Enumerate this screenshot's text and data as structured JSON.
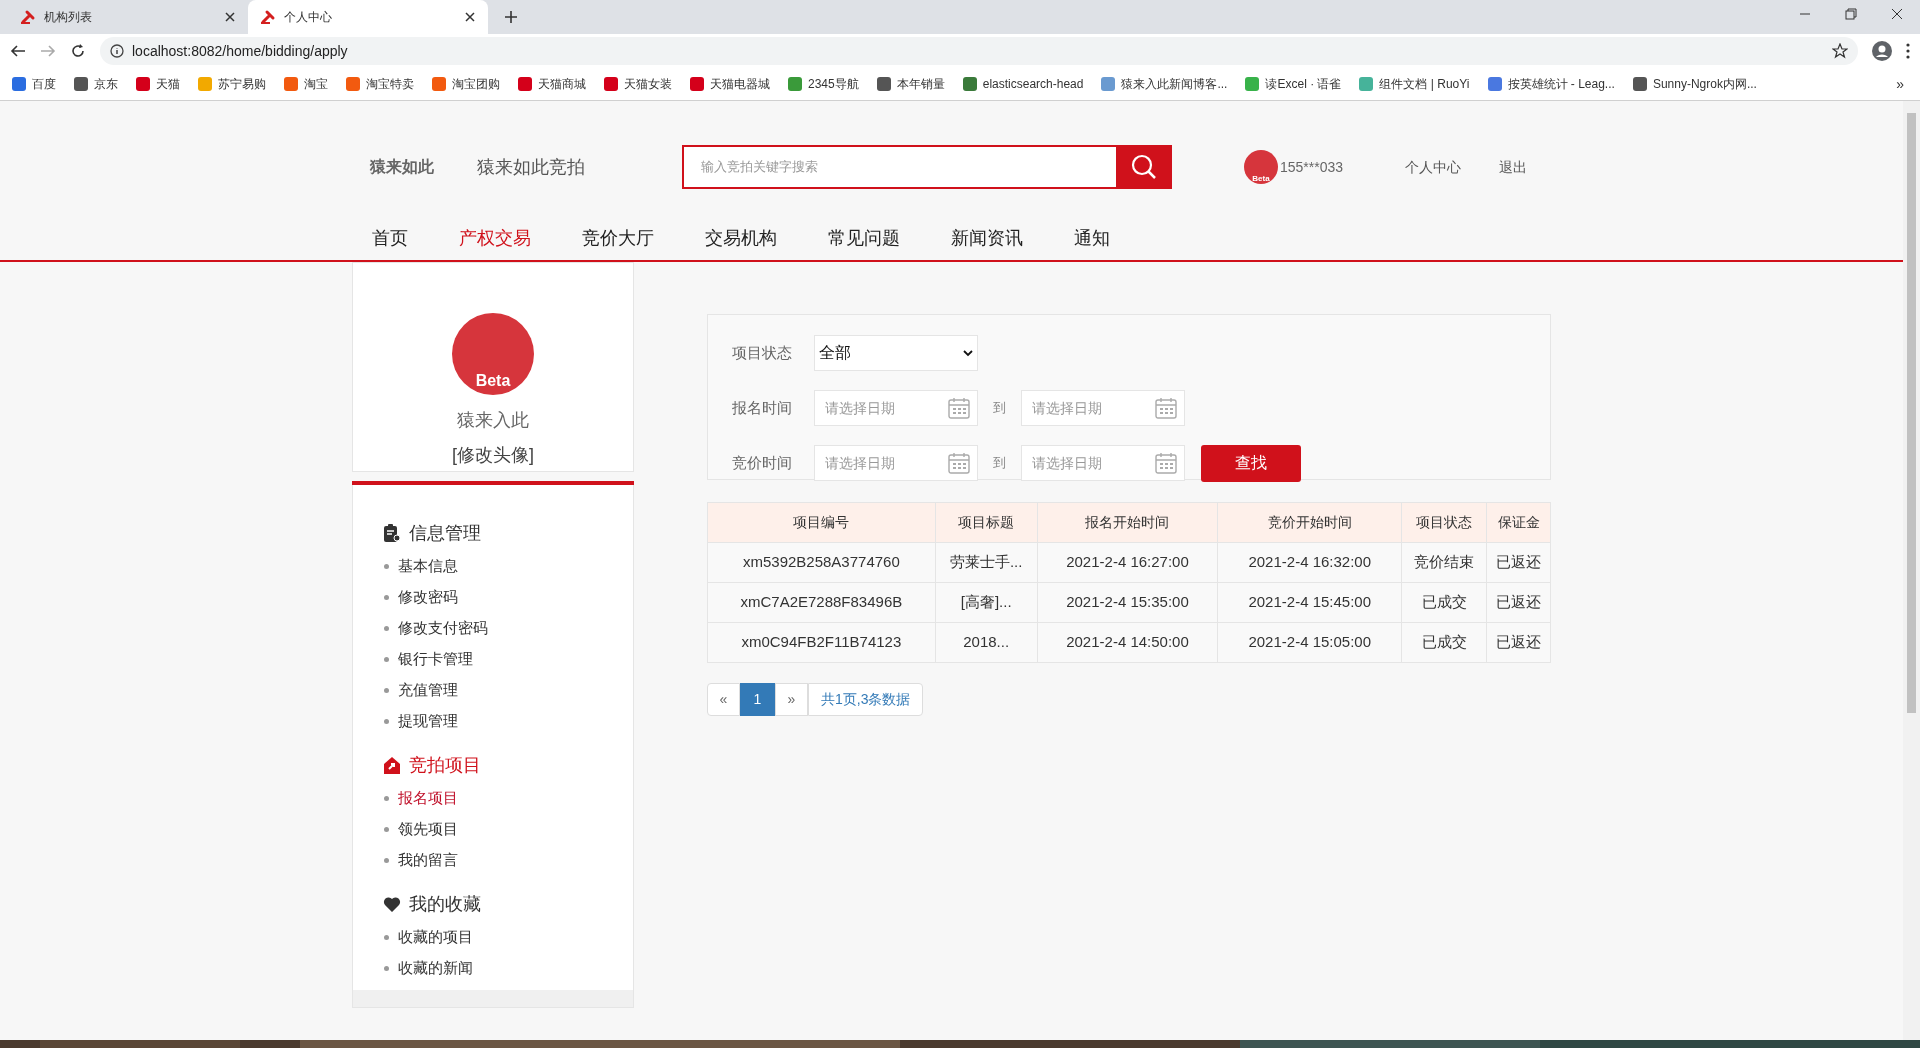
{
  "browser": {
    "tabs": [
      {
        "title": "机构列表",
        "selected": false
      },
      {
        "title": "个人中心",
        "selected": true
      }
    ],
    "url": "localhost:8082/home/bidding/apply",
    "bookmarks": [
      {
        "label": "百度",
        "color": "#2b6de0"
      },
      {
        "label": "京东",
        "color": "#555555"
      },
      {
        "label": "天猫",
        "color": "#d4001a"
      },
      {
        "label": "苏宁易购",
        "color": "#f2a900"
      },
      {
        "label": "淘宝",
        "color": "#f25a0f"
      },
      {
        "label": "淘宝特卖",
        "color": "#f25a0f"
      },
      {
        "label": "淘宝团购",
        "color": "#f25a0f"
      },
      {
        "label": "天猫商城",
        "color": "#d4001a"
      },
      {
        "label": "天猫女装",
        "color": "#d4001a"
      },
      {
        "label": "天猫电器城",
        "color": "#d4001a"
      },
      {
        "label": "2345导航",
        "color": "#3a9a3a"
      },
      {
        "label": "本年销量",
        "color": "#555555"
      },
      {
        "label": "elasticsearch-head",
        "color": "#3a7a3a"
      },
      {
        "label": "猿来入此新闻博客...",
        "color": "#6a9ad0"
      },
      {
        "label": "读Excel · 语雀",
        "color": "#38b24a"
      },
      {
        "label": "组件文档 | RuoYi",
        "color": "#46b39a"
      },
      {
        "label": "按英雄统计 - Leag...",
        "color": "#4a78e0"
      },
      {
        "label": "Sunny-Ngrok内网...",
        "color": "#555555"
      }
    ],
    "more": "»"
  },
  "header": {
    "logo": "猿来如此",
    "site_name": "猿来如此竞拍",
    "search_placeholder": "输入竞拍关键字搜索",
    "avatar_badge": "Beta",
    "user": "155***033",
    "links": [
      "个人中心",
      "退出"
    ]
  },
  "nav": [
    {
      "label": "首页",
      "selected": false
    },
    {
      "label": "产权交易",
      "selected": true
    },
    {
      "label": "竞价大厅",
      "selected": false
    },
    {
      "label": "交易机构",
      "selected": false
    },
    {
      "label": "常见问题",
      "selected": false
    },
    {
      "label": "新闻资讯",
      "selected": false
    },
    {
      "label": "通知",
      "selected": false
    }
  ],
  "sidebar": {
    "avatar_badge": "Beta",
    "name": "猿来入此",
    "change_avatar": "[修改头像]",
    "sections": [
      {
        "title": "信息管理",
        "kind": "clipboard",
        "selected": false,
        "items": [
          {
            "label": "基本信息",
            "selected": false
          },
          {
            "label": "修改密码",
            "selected": false
          },
          {
            "label": "修改支付密码",
            "selected": false
          },
          {
            "label": "银行卡管理",
            "selected": false
          },
          {
            "label": "充值管理",
            "selected": false
          },
          {
            "label": "提现管理",
            "selected": false
          }
        ]
      },
      {
        "title": "竞拍项目",
        "kind": "house",
        "selected": true,
        "items": [
          {
            "label": "报名项目",
            "selected": true
          },
          {
            "label": "领先项目",
            "selected": false
          },
          {
            "label": "我的留言",
            "selected": false
          }
        ]
      },
      {
        "title": "我的收藏",
        "kind": "heart",
        "selected": false,
        "items": [
          {
            "label": "收藏的项目",
            "selected": false
          },
          {
            "label": "收藏的新闻",
            "selected": false
          }
        ]
      }
    ]
  },
  "filters": {
    "status_label": "项目状态",
    "status_value": "全部",
    "ranges": [
      {
        "label": "报名时间",
        "from_placeholder": "请选择日期",
        "to": "到",
        "to_placeholder": "请选择日期"
      },
      {
        "label": "竞价时间",
        "from_placeholder": "请选择日期",
        "to": "到",
        "to_placeholder": "请选择日期"
      }
    ],
    "search_button": "查找"
  },
  "table": {
    "columns": [
      "项目编号",
      "项目标题",
      "报名开始时间",
      "竞价开始时间",
      "项目状态",
      "保证金"
    ],
    "rows": [
      [
        "xm5392B258A3774760",
        "劳莱士手...",
        "2021-2-4 16:27:00",
        "2021-2-4 16:32:00",
        "竞价结束",
        "已返还"
      ],
      [
        "xmC7A2E7288F83496B",
        "[高奢]...",
        "2021-2-4 15:35:00",
        "2021-2-4 15:45:00",
        "已成交",
        "已返还"
      ],
      [
        "xm0C94FB2F11B74123",
        "2018...",
        "2021-2-4 14:50:00",
        "2021-2-4 15:05:00",
        "已成交",
        "已返还"
      ]
    ]
  },
  "pagination": {
    "prev": "«",
    "pages": [
      {
        "label": "1",
        "selected": true
      }
    ],
    "next": "»",
    "summary": "共1页,3条数据"
  }
}
